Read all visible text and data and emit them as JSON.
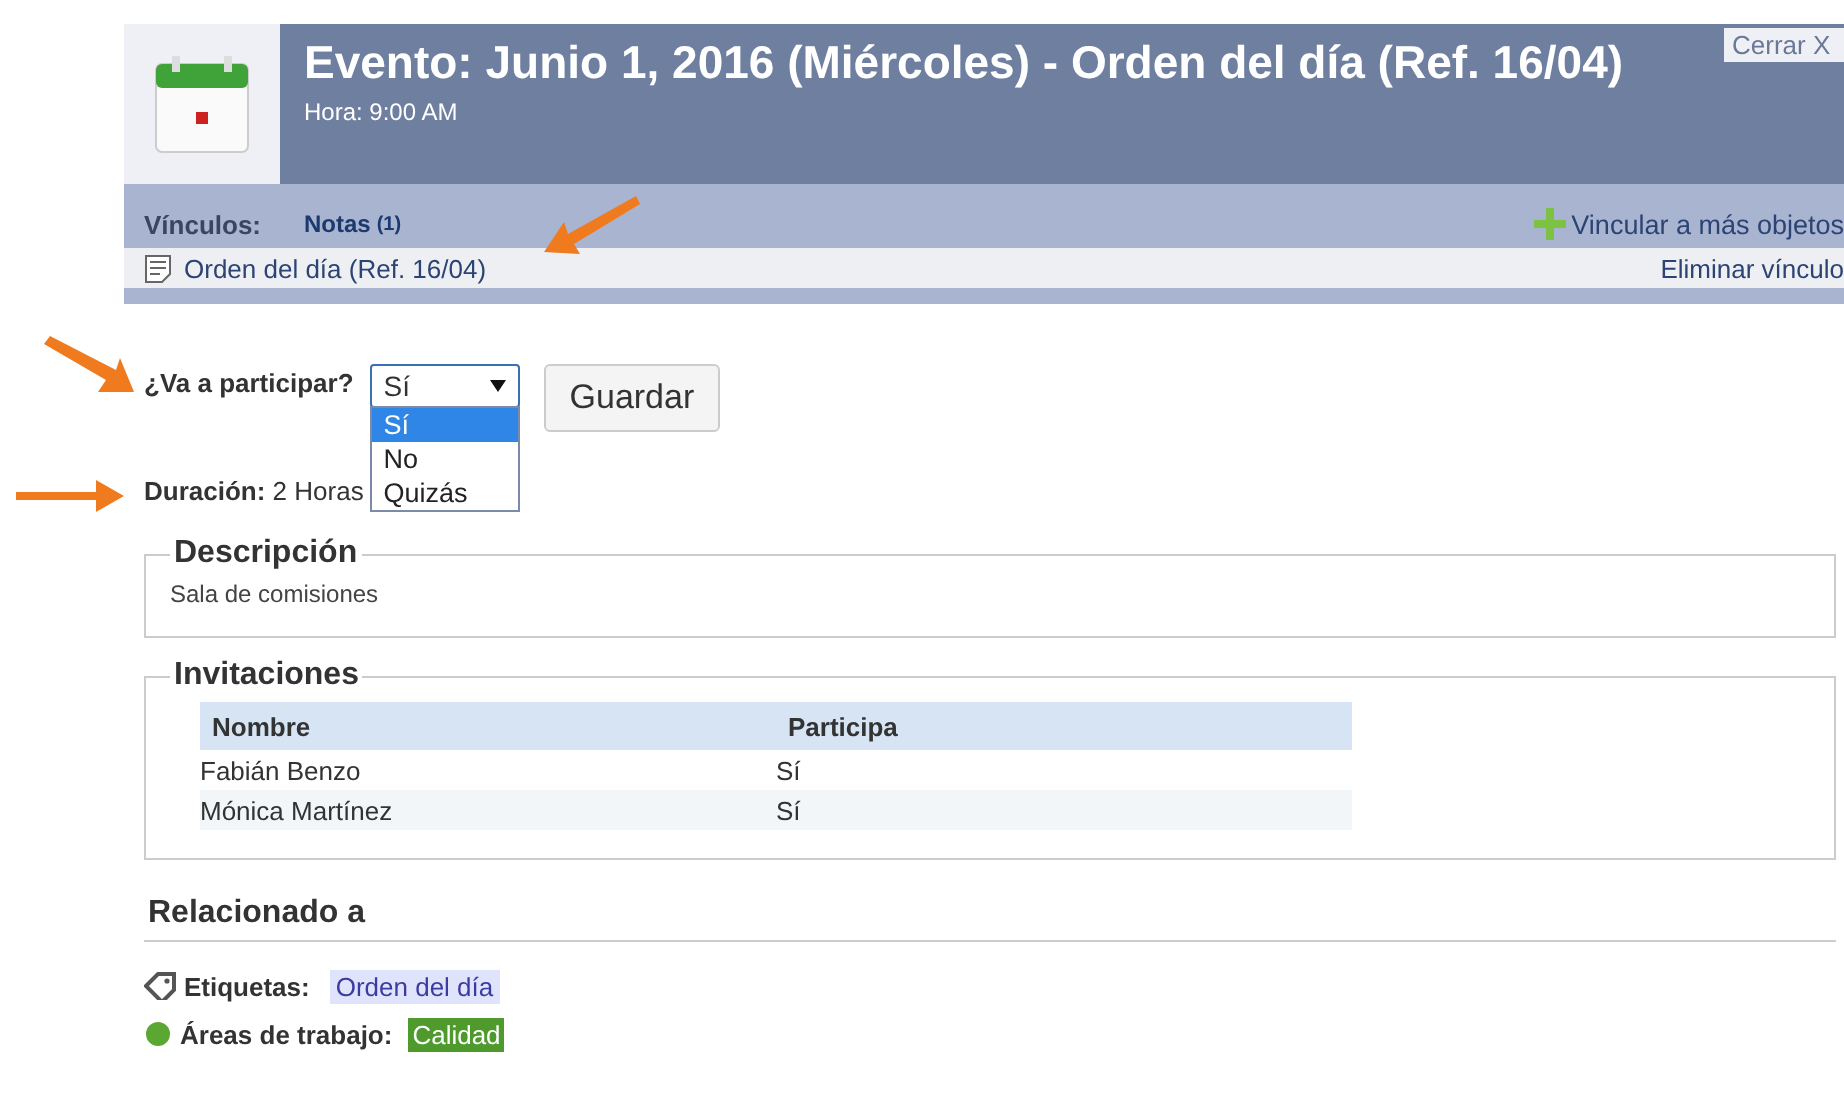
{
  "header": {
    "title": "Evento: Junio 1, 2016 (Miércoles) - Orden del día (Ref. 16/04)",
    "time": "Hora: 9:00 AM",
    "close": "Cerrar X"
  },
  "links": {
    "label": "Vínculos:",
    "tab": "Notas",
    "count": "(1)",
    "add": "Vincular a más objetos",
    "item": "Orden del día (Ref. 16/04)",
    "remove": "Eliminar vínculo"
  },
  "attend": {
    "label": "¿Va a participar?",
    "value": "Sí",
    "expanded": true,
    "options": [
      {
        "label": "Sí",
        "selected": true
      },
      {
        "label": "No",
        "selected": false
      },
      {
        "label": "Quizás",
        "selected": false
      }
    ],
    "save": "Guardar"
  },
  "duration": {
    "label": "Duración:",
    "value": "2 Horas"
  },
  "description": {
    "legend": "Descripción",
    "text": "Sala de comisiones"
  },
  "invitations": {
    "legend": "Invitaciones",
    "columns": [
      "Nombre",
      "Participa"
    ],
    "rows": [
      [
        "Fabián Benzo",
        "Sí"
      ],
      [
        "Mónica Martínez",
        "Sí"
      ]
    ]
  },
  "related": {
    "title": "Relacionado a",
    "tags_label": "Etiquetas:",
    "tag": "Orden del día",
    "areas_label": "Áreas de trabajo:",
    "area": "Calidad"
  }
}
